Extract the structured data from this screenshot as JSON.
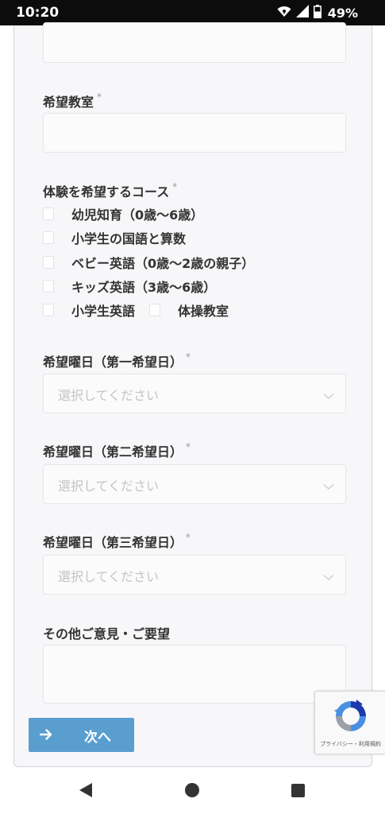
{
  "status_bar": {
    "time": "10:20",
    "battery_percent": "49%",
    "icons": [
      "wifi-icon",
      "signal-icon",
      "battery-icon"
    ]
  },
  "form": {
    "hope_classroom": {
      "label": "希望教室",
      "required_mark": "*",
      "value": ""
    },
    "trial_course": {
      "label": "体験を希望するコース",
      "required_mark": "*",
      "options": [
        {
          "label": "幼児知育（0歳〜6歳）",
          "checked": false
        },
        {
          "label": "小学生の国語と算数",
          "checked": false
        },
        {
          "label": "ベビー英語（0歳〜2歳の親子）",
          "checked": false
        },
        {
          "label": "キッズ英語（3歳〜6歳）",
          "checked": false
        },
        {
          "label": "小学生英語",
          "checked": false
        },
        {
          "label": "体操教室",
          "checked": false
        }
      ]
    },
    "day_first": {
      "label": "希望曜日（第一希望日）",
      "required_mark": "*",
      "placeholder": "選択してください"
    },
    "day_second": {
      "label": "希望曜日（第二希望日）",
      "required_mark": "*",
      "placeholder": "選択してください"
    },
    "day_third": {
      "label": "希望曜日（第三希望日）",
      "required_mark": "*",
      "placeholder": "選択してください"
    },
    "other_comments": {
      "label": "その他ご意見・ご要望",
      "value": ""
    },
    "next_button": {
      "label": "次へ",
      "icon": "arrow-right-icon"
    }
  },
  "recaptcha": {
    "text": "プライバシー・利用規約"
  },
  "colors": {
    "status_bar_bg": "#0c0c0c",
    "button_bg": "#5a9ed0",
    "placeholder": "#c4c4c8"
  },
  "nav_bar": {
    "icons": [
      "back-icon",
      "home-icon",
      "recents-icon"
    ]
  }
}
